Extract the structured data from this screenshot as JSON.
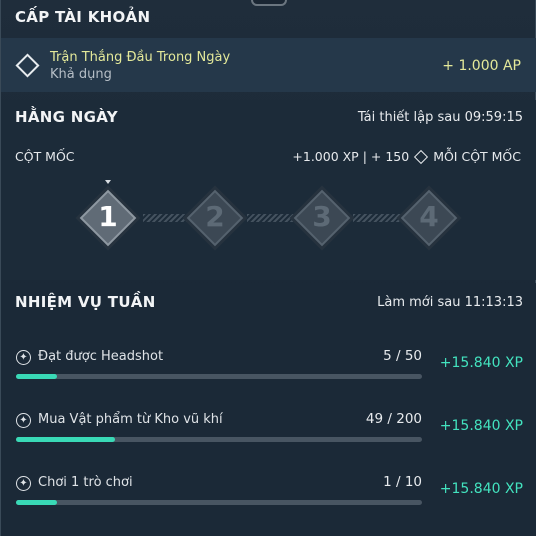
{
  "account_level": {
    "title": "CẤP TÀI KHOẢN",
    "item_title": "Trận Thắng Đầu Trong Ngày",
    "item_status": "Khả dụng",
    "reward": "+ 1.000 AP"
  },
  "daily": {
    "title": "HẰNG NGÀY",
    "reset_text": "Tái thiết lập sau 09:59:15",
    "milestone_label": "CỘT MỐC",
    "milestone_reward_left": "+1.000 XP | + 150",
    "milestone_reward_right": "MỖI CỘT MỐC",
    "milestones": [
      {
        "label": "1",
        "active": true
      },
      {
        "label": "2",
        "active": false
      },
      {
        "label": "3",
        "active": false
      },
      {
        "label": "4",
        "active": false
      }
    ]
  },
  "weekly": {
    "title": "NHIỆM VỤ TUẦN",
    "refresh_text": "Làm mới sau 11:13:13",
    "quests": [
      {
        "name": "Đạt được Headshot",
        "count": "5 / 50",
        "progress": 0.1,
        "reward": "+15.840 XP"
      },
      {
        "name": "Mua Vật phẩm từ Kho vũ khí",
        "count": "49 / 200",
        "progress": 0.245,
        "reward": "+15.840 XP"
      },
      {
        "name": "Chơi 1 trò chơi",
        "count": "1 / 10",
        "progress": 0.1,
        "reward": "+15.840 XP"
      }
    ]
  },
  "colors": {
    "accent_yellow": "#e4e99a",
    "progress_teal": "#39d9b6",
    "xp_teal": "#43e3bf"
  }
}
